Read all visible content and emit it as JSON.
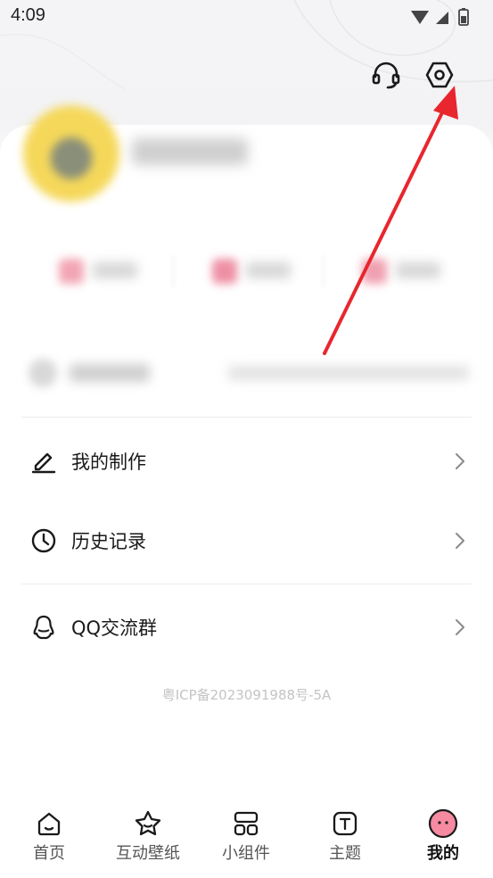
{
  "status_bar": {
    "time": "4:09"
  },
  "header": {
    "support_icon": "headset-icon",
    "settings_icon": "hexagon-settings-icon"
  },
  "menu": [
    {
      "label": "我的制作",
      "icon": "pencil-icon"
    },
    {
      "label": "历史记录",
      "icon": "clock-icon"
    },
    {
      "label": "QQ交流群",
      "icon": "qq-penguin-icon"
    }
  ],
  "footer": {
    "icp": "粤ICP备2023091988号-5A"
  },
  "tabbar": {
    "items": [
      {
        "label": "首页",
        "icon": "home-icon"
      },
      {
        "label": "互动壁纸",
        "icon": "star-icon"
      },
      {
        "label": "小组件",
        "icon": "widget-grid-icon"
      },
      {
        "label": "主题",
        "icon": "theme-t-icon"
      },
      {
        "label": "我的",
        "icon": "pink-face-icon",
        "active": true
      }
    ]
  },
  "colors": {
    "annotation_arrow": "#e8262e",
    "accent_pink": "#f58aa0"
  }
}
